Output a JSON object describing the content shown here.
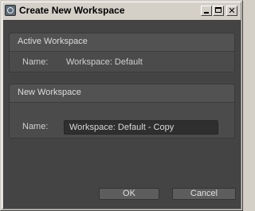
{
  "window": {
    "title": "Create New Workspace",
    "controls": {
      "minimize": "minimize",
      "maximize": "maximize",
      "close": "close"
    }
  },
  "active_workspace": {
    "heading": "Active Workspace",
    "name_label": "Name:",
    "name_value": "Workspace: Default"
  },
  "new_workspace": {
    "heading": "New Workspace",
    "name_label": "Name:",
    "name_value": "Workspace: Default - Copy"
  },
  "buttons": {
    "ok": "OK",
    "cancel": "Cancel"
  },
  "icons": {
    "app": "app-icon",
    "minimize": "minimize-icon",
    "maximize": "maximize-icon",
    "close": "close-icon"
  },
  "colors": {
    "title_bar": "#d4d0c8",
    "client_background": "#444444",
    "group_background": "#4b4b4b",
    "input_background": "#2f2f2f",
    "text": "#d0d0d0"
  }
}
